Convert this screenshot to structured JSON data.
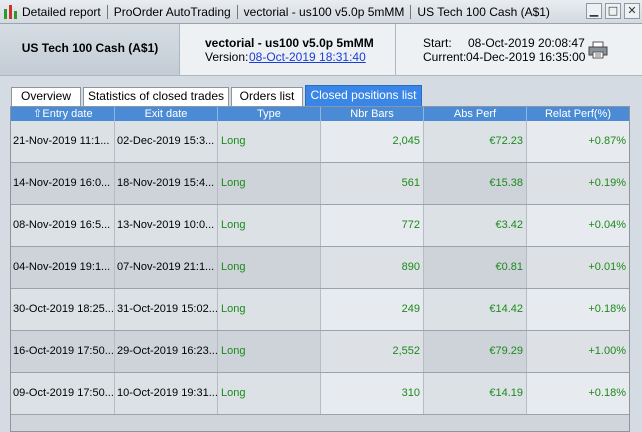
{
  "window": {
    "title_parts": [
      "Detailed report",
      "ProOrder AutoTrading",
      "vectorial - us100 v5.0p 5mMM",
      "US Tech 100 Cash (A$1)"
    ],
    "controls": [
      "minimize",
      "maximize",
      "close"
    ]
  },
  "header": {
    "instrument": "US Tech 100 Cash (A$1)",
    "strategy_name": "vectorial - us100 v5.0p 5mMM",
    "version_label": "Version:",
    "version_link": "08-Oct-2019 18:31:40",
    "start_label": "Start:",
    "start_value": "08-Oct-2019 20:08:47",
    "current_label": "Current:",
    "current_value": "04-Dec-2019 16:35:00"
  },
  "tabs": [
    {
      "label": "Overview",
      "active": false
    },
    {
      "label": "Statistics of closed trades",
      "active": false
    },
    {
      "label": "Orders list",
      "active": false
    },
    {
      "label": "Closed positions list",
      "active": true
    }
  ],
  "table": {
    "columns": [
      "Entry date",
      "Exit date",
      "Type",
      "Nbr Bars",
      "Abs Perf",
      "Relat Perf(%)"
    ],
    "sorted_column": "Entry date",
    "rows": [
      {
        "entry": "21-Nov-2019 11:1...",
        "exit": "02-Dec-2019 15:3...",
        "type": "Long",
        "bars": "2,045",
        "abs": "€72.23",
        "rel": "+0.87%"
      },
      {
        "entry": "14-Nov-2019 16:0...",
        "exit": "18-Nov-2019 15:4...",
        "type": "Long",
        "bars": "561",
        "abs": "€15.38",
        "rel": "+0.19%"
      },
      {
        "entry": "08-Nov-2019 16:5...",
        "exit": "13-Nov-2019 10:0...",
        "type": "Long",
        "bars": "772",
        "abs": "€3.42",
        "rel": "+0.04%"
      },
      {
        "entry": "04-Nov-2019 19:1...",
        "exit": "07-Nov-2019 21:1...",
        "type": "Long",
        "bars": "890",
        "abs": "€0.81",
        "rel": "+0.01%"
      },
      {
        "entry": "30-Oct-2019 18:25...",
        "exit": "31-Oct-2019 15:02...",
        "type": "Long",
        "bars": "249",
        "abs": "€14.42",
        "rel": "+0.18%"
      },
      {
        "entry": "16-Oct-2019 17:50...",
        "exit": "29-Oct-2019 16:23...",
        "type": "Long",
        "bars": "2,552",
        "abs": "€79.29",
        "rel": "+1.00%"
      },
      {
        "entry": "09-Oct-2019 17:50...",
        "exit": "10-Oct-2019 19:31...",
        "type": "Long",
        "bars": "310",
        "abs": "€14.19",
        "rel": "+0.18%"
      }
    ]
  },
  "colors": {
    "active_tab": "#3a86e6",
    "table_header": "#4b8bd6",
    "positive_text": "#1c8a1c",
    "link": "#1a3fd6"
  }
}
